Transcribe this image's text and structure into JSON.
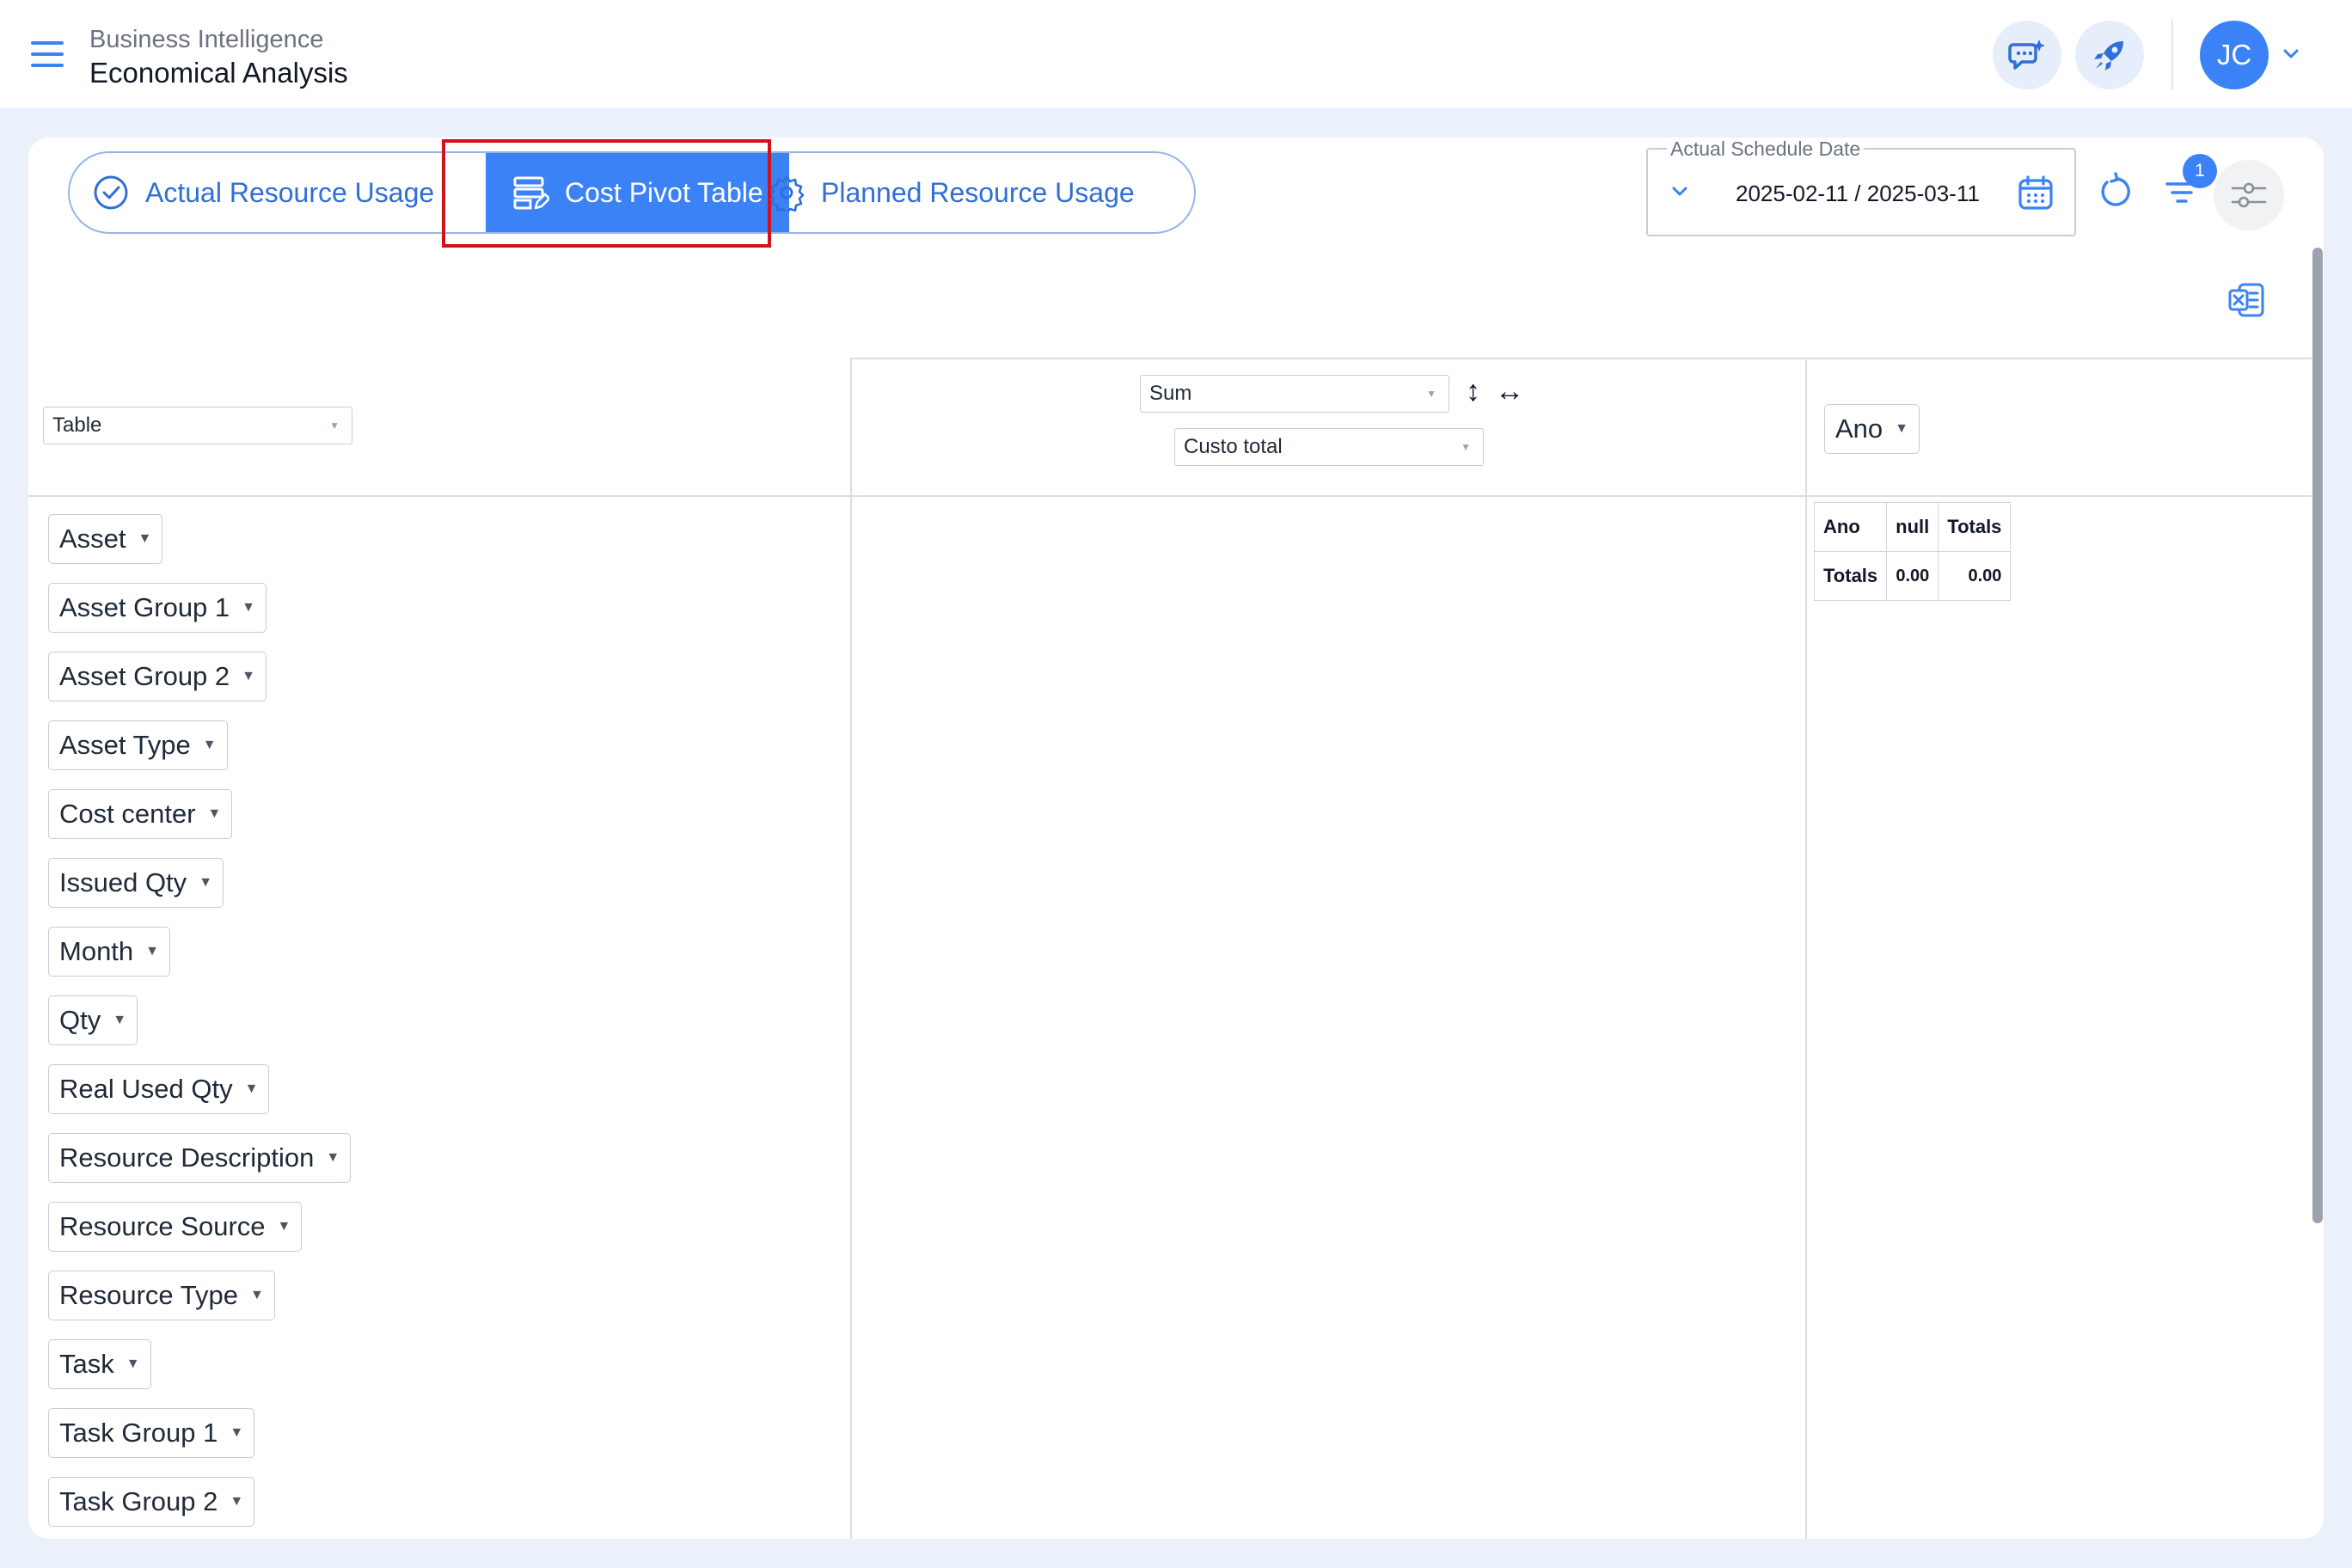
{
  "header": {
    "module": "Business Intelligence",
    "page": "Economical Analysis",
    "user_initials": "JC"
  },
  "tabs": [
    {
      "label": "Actual Resource Usage",
      "icon": "check-circle-icon",
      "active": false
    },
    {
      "label": "Cost Pivot Table",
      "icon": "table-edit-icon",
      "active": true
    },
    {
      "label": "Planned Resource Usage",
      "icon": "gear-icon",
      "active": false
    }
  ],
  "schedule": {
    "legend": "Actual Schedule Date",
    "value": "2025-02-11 / 2025-03-11"
  },
  "filter_badge": "1",
  "pivot": {
    "renderer": "Table",
    "aggregator": "Sum",
    "value_field": "Custo total",
    "row_order_symbol": "↕",
    "col_order_symbol": "↔",
    "col_field": "Ano",
    "row_fields": [
      "Asset",
      "Asset Group 1",
      "Asset Group 2",
      "Asset Type",
      "Cost center",
      "Issued Qty",
      "Month",
      "Qty",
      "Real Used Qty",
      "Resource Description",
      "Resource Source",
      "Resource Type",
      "Task",
      "Task Group 1",
      "Task Group 2"
    ],
    "result": {
      "header": [
        "Ano",
        "null",
        "Totals"
      ],
      "totals_label": "Totals",
      "totals": [
        "0.00",
        "0.00"
      ]
    }
  },
  "colors": {
    "accent": "#3b82f6",
    "highlight": "#d0121b",
    "background": "#ebf1fb"
  }
}
